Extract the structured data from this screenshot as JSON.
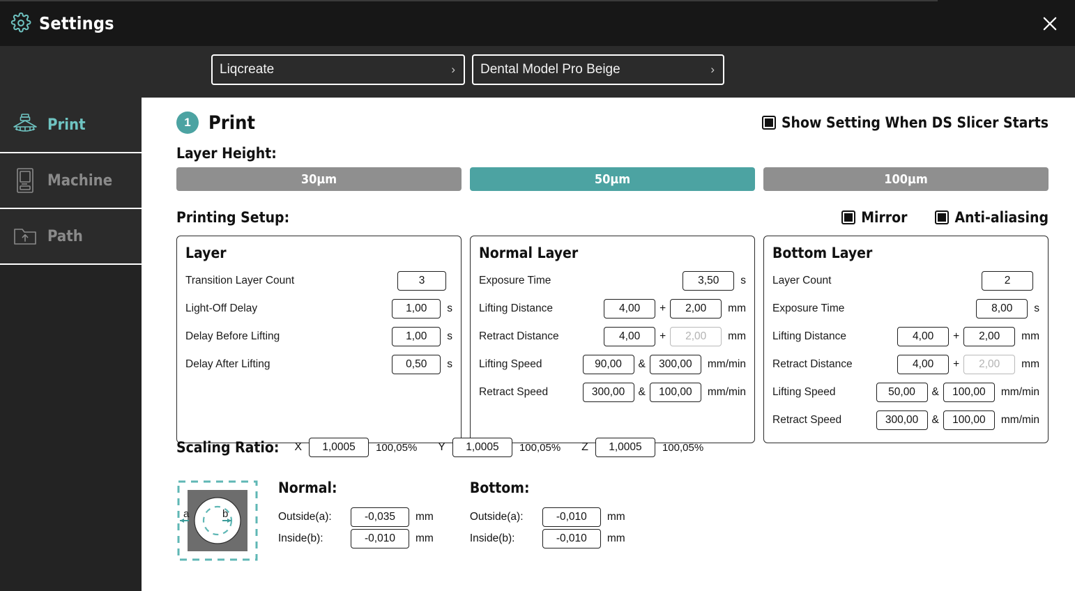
{
  "window": {
    "title": "Settings",
    "gear_icon": "gear-icon",
    "close_icon": "close-icon"
  },
  "toolbar": {
    "brand_select": {
      "value": "Liqcreate",
      "chevron": "›"
    },
    "resin_select": {
      "value": "Dental Model Pro Beige",
      "chevron": "›"
    },
    "buttons": [
      {
        "name": "reset-button",
        "icon": "reset-icon"
      },
      {
        "name": "import-button",
        "icon": "import-icon"
      },
      {
        "name": "export-button",
        "icon": "export-icon"
      },
      {
        "name": "export-all-button",
        "icon": "export-all-icon"
      }
    ]
  },
  "sidebar": {
    "items": [
      {
        "label": "Print",
        "icon": "printer-icon",
        "active": true
      },
      {
        "label": "Machine",
        "icon": "machine-icon",
        "active": false
      },
      {
        "label": "Path",
        "icon": "folder-upload-icon",
        "active": false
      }
    ]
  },
  "main": {
    "step_number": "1",
    "section_title": "Print",
    "show_setting_checkbox": {
      "label": "Show Setting When DS Slicer Starts",
      "checked": true
    },
    "layer_height_label": "Layer Height:",
    "layer_height_options": [
      {
        "label": "30µm",
        "selected": false
      },
      {
        "label": "50µm",
        "selected": true
      },
      {
        "label": "100µm",
        "selected": false
      }
    ],
    "printing_setup_label": "Printing Setup:",
    "mirror_checkbox": {
      "label": "Mirror",
      "checked": true
    },
    "antialiasing_checkbox": {
      "label": "Anti-aliasing",
      "checked": true
    }
  },
  "panels": {
    "layer": {
      "title": "Layer",
      "rows": [
        {
          "label": "Transition Layer Count",
          "v1": "3",
          "unit": ""
        },
        {
          "label": "Light-Off Delay",
          "v1": "1,00",
          "unit": "s"
        },
        {
          "label": "Delay Before Lifting",
          "v1": "1,00",
          "unit": "s"
        },
        {
          "label": "Delay After Lifting",
          "v1": "0,50",
          "unit": "s"
        }
      ]
    },
    "normal_layer": {
      "title": "Normal Layer",
      "rows": [
        {
          "label": "Exposure Time",
          "v1": "3,50",
          "unit": "s"
        },
        {
          "label": "Lifting Distance",
          "v1": "4,00",
          "op": "+",
          "v2": "2,00",
          "unit": "mm",
          "v2_disabled": false
        },
        {
          "label": "Retract Distance",
          "v1": "4,00",
          "op": "+",
          "v2": "2,00",
          "unit": "mm",
          "v2_disabled": true
        },
        {
          "label": "Lifting Speed",
          "v1": "90,00",
          "op": "&",
          "v2": "300,00",
          "unit": "mm/min",
          "v2_disabled": false
        },
        {
          "label": "Retract Speed",
          "v1": "300,00",
          "op": "&",
          "v2": "100,00",
          "unit": "mm/min",
          "v2_disabled": false
        }
      ]
    },
    "bottom_layer": {
      "title": "Bottom Layer",
      "rows": [
        {
          "label": "Layer Count",
          "v1": "2",
          "unit": ""
        },
        {
          "label": "Exposure Time",
          "v1": "8,00",
          "unit": "s"
        },
        {
          "label": "Lifting Distance",
          "v1": "4,00",
          "op": "+",
          "v2": "2,00",
          "unit": "mm",
          "v2_disabled": false
        },
        {
          "label": "Retract Distance",
          "v1": "4,00",
          "op": "+",
          "v2": "2,00",
          "unit": "mm",
          "v2_disabled": true
        },
        {
          "label": "Lifting Speed",
          "v1": "50,00",
          "op": "&",
          "v2": "100,00",
          "unit": "mm/min",
          "v2_disabled": false
        },
        {
          "label": "Retract Speed",
          "v1": "300,00",
          "op": "&",
          "v2": "100,00",
          "unit": "mm/min",
          "v2_disabled": false
        }
      ]
    }
  },
  "scaling": {
    "title": "Scaling Ratio:",
    "axes": [
      {
        "axis": "X",
        "value": "1,0005",
        "percent": "100,05%"
      },
      {
        "axis": "Y",
        "value": "1,0005",
        "percent": "100,05%"
      },
      {
        "axis": "Z",
        "value": "1,0005",
        "percent": "100,05%"
      }
    ]
  },
  "compensation": {
    "diagram": {
      "name": "compensation-diagram",
      "label_a": "a",
      "label_b": "b"
    },
    "normal": {
      "title": "Normal:",
      "outside": {
        "label": "Outside(a):",
        "value": "-0,035",
        "unit": "mm"
      },
      "inside": {
        "label": "Inside(b):",
        "value": "-0,010",
        "unit": "mm"
      }
    },
    "bottom": {
      "title": "Bottom:",
      "outside": {
        "label": "Outside(a):",
        "value": "-0,010",
        "unit": "mm"
      },
      "inside": {
        "label": "Inside(b):",
        "value": "-0,010",
        "unit": "mm"
      }
    }
  },
  "colors": {
    "accent": "#4ca3a2",
    "titlebar_bg": "#171717",
    "toolbar_bg": "#2b2b2b",
    "sidebar_bg": "#2b2b2b",
    "inactive_button": "#8f8f8f"
  }
}
